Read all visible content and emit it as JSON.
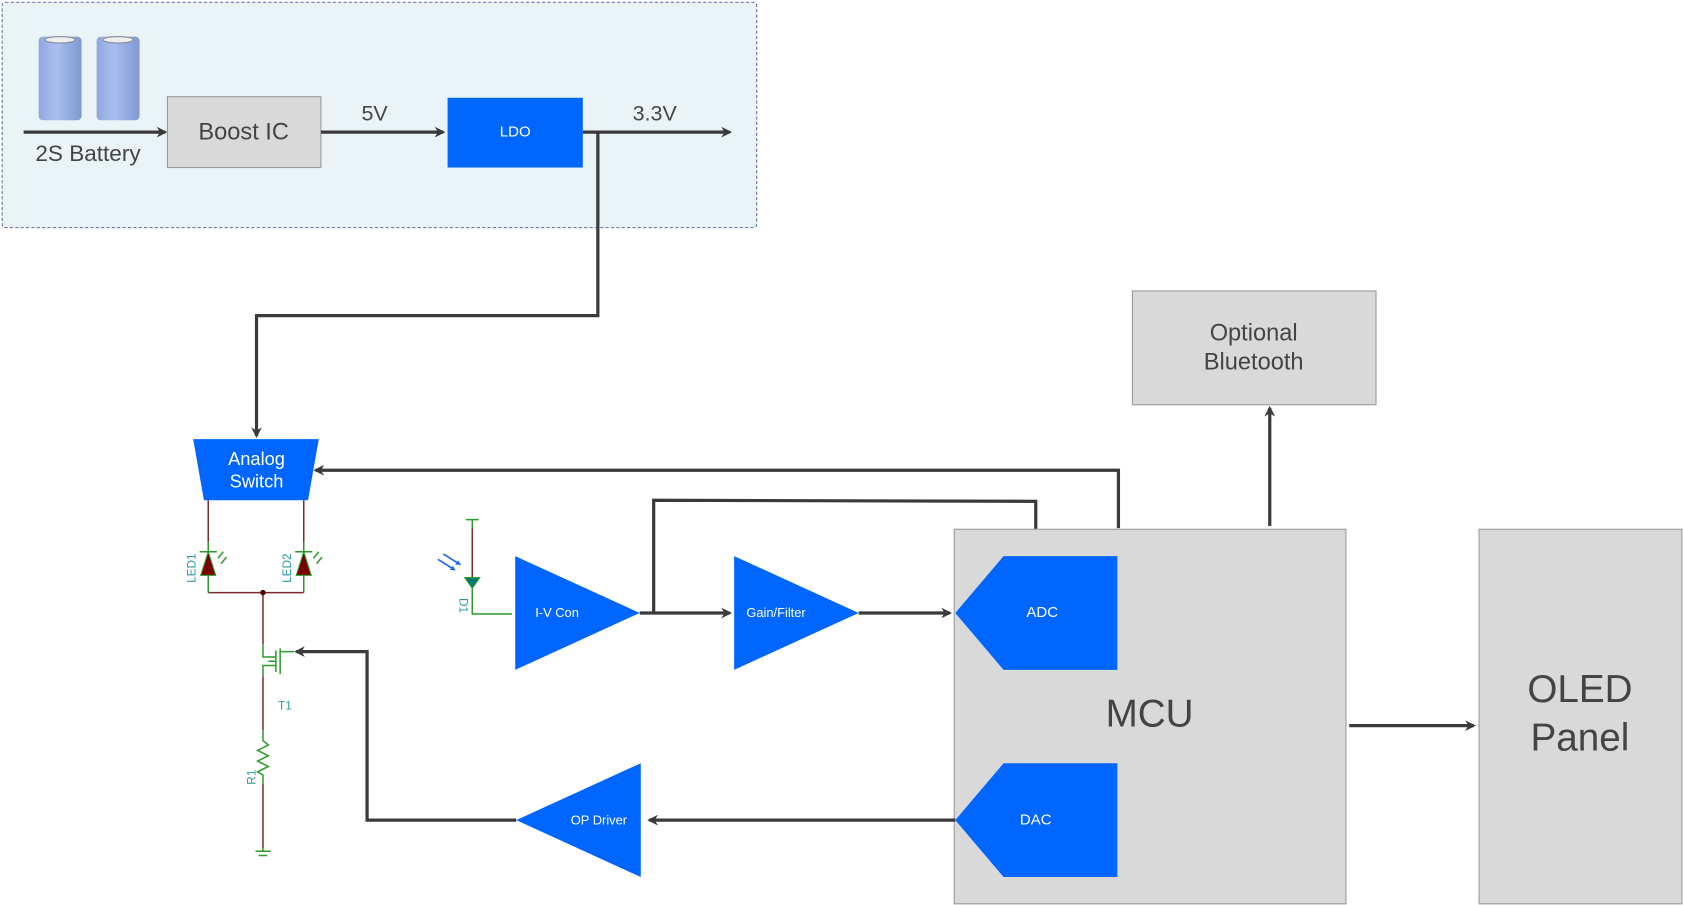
{
  "colors": {
    "block_blue": "#0066ff",
    "block_grey": "#d9d9d9",
    "power_region": "#eaf3f5",
    "arrow": "#3a3a3a",
    "led": "#7a0000",
    "circuit_green": "#2a9a2a"
  },
  "power": {
    "battery_label": "2S Battery",
    "boost_label": "Boost IC",
    "v5_label": "5V",
    "ldo_label": "LDO",
    "v33_label": "3.3V"
  },
  "analog_switch": {
    "line1": "Analog",
    "line2": "Switch"
  },
  "circuit": {
    "led1": "LED1",
    "led2": "LED2",
    "t1": "T1",
    "r1": "R1",
    "d1": "D1"
  },
  "signal": {
    "iv": "I-V Con",
    "gain": "Gain/Filter",
    "op": "OP Driver"
  },
  "mcu": {
    "label": "MCU",
    "adc": "ADC",
    "dac": "DAC"
  },
  "bluetooth": {
    "line1": "Optional",
    "line2": "Bluetooth"
  },
  "oled": {
    "line1": "OLED",
    "line2": "Panel"
  }
}
